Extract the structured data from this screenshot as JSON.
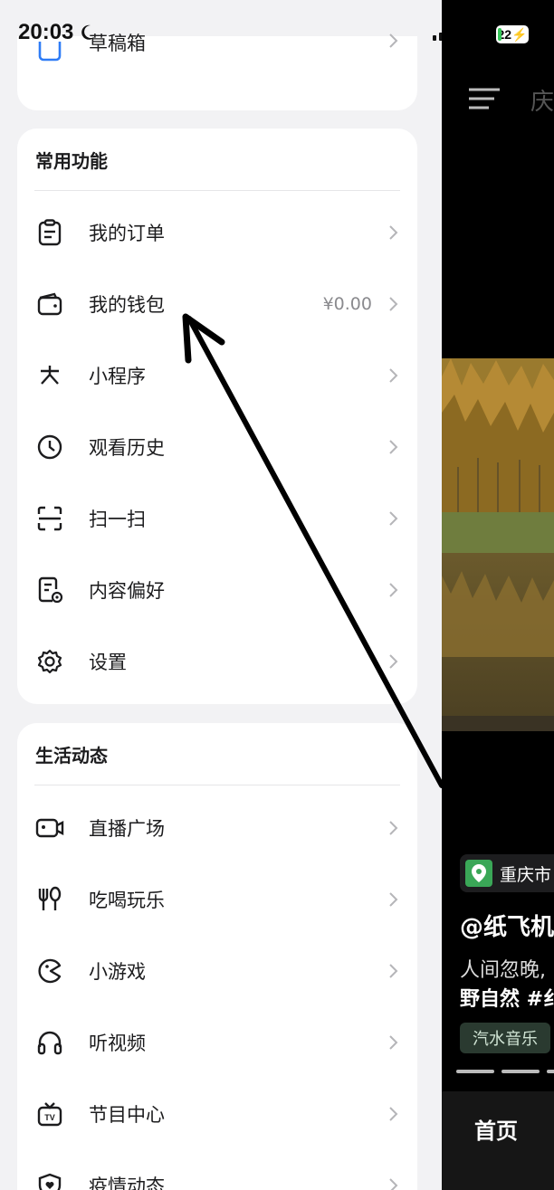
{
  "status_bar": {
    "time": "20:03",
    "battery": "22"
  },
  "drawer": {
    "top_card": {
      "label": "草稿箱"
    },
    "common": {
      "title": "常用功能",
      "items": [
        {
          "label": "我的订单",
          "icon": "clipboard-icon",
          "value": ""
        },
        {
          "label": "我的钱包",
          "icon": "wallet-icon",
          "value": "¥0.00"
        },
        {
          "label": "小程序",
          "icon": "mini-program-icon",
          "value": ""
        },
        {
          "label": "观看历史",
          "icon": "clock-icon",
          "value": ""
        },
        {
          "label": "扫一扫",
          "icon": "scan-icon",
          "value": ""
        },
        {
          "label": "内容偏好",
          "icon": "preference-doc-icon",
          "value": ""
        },
        {
          "label": "设置",
          "icon": "gear-icon",
          "value": ""
        }
      ]
    },
    "life": {
      "title": "生活动态",
      "items": [
        {
          "label": "直播广场",
          "icon": "live-camera-icon"
        },
        {
          "label": "吃喝玩乐",
          "icon": "fork-spoon-icon"
        },
        {
          "label": "小游戏",
          "icon": "pacman-game-icon"
        },
        {
          "label": "听视频",
          "icon": "headphones-icon"
        },
        {
          "label": "节目中心",
          "icon": "tv-icon"
        },
        {
          "label": "疫情动态",
          "icon": "shield-heart-icon"
        }
      ]
    }
  },
  "feed": {
    "top_tab": "庆",
    "location": "重庆市",
    "author": "@纸飞机",
    "desc_line1": "人间忽晚,",
    "desc_line2": "野自然 #纟",
    "music": "汽水音乐",
    "bottom_tab": "首页"
  },
  "colors": {
    "accent_green": "#3aa757",
    "wallet_arrow": "#000000"
  }
}
